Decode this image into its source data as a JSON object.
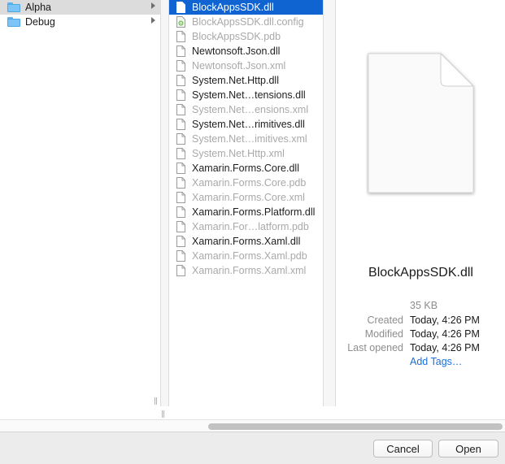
{
  "folders": [
    {
      "label": "Alpha",
      "selected": true
    },
    {
      "label": "Debug",
      "selected": false
    }
  ],
  "files": [
    {
      "label": "BlockAppsSDK.dll",
      "state": "selected",
      "icon": "document-icon"
    },
    {
      "label": "BlockAppsSDK.dll.config",
      "state": "dim",
      "icon": "config-file-icon"
    },
    {
      "label": "BlockAppsSDK.pdb",
      "state": "dim",
      "icon": "document-icon"
    },
    {
      "label": "Newtonsoft.Json.dll",
      "state": "normal",
      "icon": "document-icon"
    },
    {
      "label": "Newtonsoft.Json.xml",
      "state": "dim",
      "icon": "document-icon"
    },
    {
      "label": "System.Net.Http.dll",
      "state": "normal",
      "icon": "document-icon"
    },
    {
      "label": "System.Net…tensions.dll",
      "state": "normal",
      "icon": "document-icon"
    },
    {
      "label": "System.Net…ensions.xml",
      "state": "dim",
      "icon": "document-icon"
    },
    {
      "label": "System.Net…rimitives.dll",
      "state": "normal",
      "icon": "document-icon"
    },
    {
      "label": "System.Net…imitives.xml",
      "state": "dim",
      "icon": "document-icon"
    },
    {
      "label": "System.Net.Http.xml",
      "state": "dim",
      "icon": "document-icon"
    },
    {
      "label": "Xamarin.Forms.Core.dll",
      "state": "normal",
      "icon": "document-icon"
    },
    {
      "label": "Xamarin.Forms.Core.pdb",
      "state": "dim",
      "icon": "document-icon"
    },
    {
      "label": "Xamarin.Forms.Core.xml",
      "state": "dim",
      "icon": "document-icon"
    },
    {
      "label": "Xamarin.Forms.Platform.dll",
      "state": "normal",
      "icon": "document-icon"
    },
    {
      "label": "Xamarin.For…latform.pdb",
      "state": "dim",
      "icon": "document-icon"
    },
    {
      "label": "Xamarin.Forms.Xaml.dll",
      "state": "normal",
      "icon": "document-icon"
    },
    {
      "label": "Xamarin.Forms.Xaml.pdb",
      "state": "dim",
      "icon": "document-icon"
    },
    {
      "label": "Xamarin.Forms.Xaml.xml",
      "state": "dim",
      "icon": "document-icon"
    }
  ],
  "preview": {
    "name": "BlockAppsSDK.dll",
    "size": "35 KB",
    "created_label": "Created",
    "created_value": "Today, 4:26 PM",
    "modified_label": "Modified",
    "modified_value": "Today, 4:26 PM",
    "opened_label": "Last opened",
    "opened_value": "Today, 4:26 PM",
    "add_tags": "Add Tags…"
  },
  "buttons": {
    "cancel": "Cancel",
    "open": "Open"
  },
  "colors": {
    "selection": "#0f64d2",
    "folder": "#7dc5f6",
    "link": "#1a6fd8"
  }
}
